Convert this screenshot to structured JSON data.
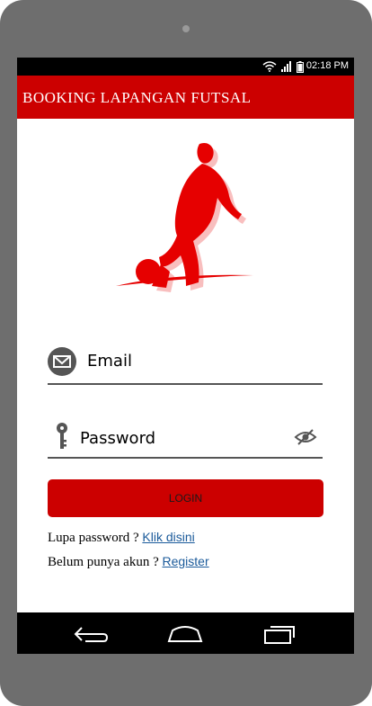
{
  "status_bar": {
    "time": "02:18 PM"
  },
  "app_bar": {
    "title": "BOOKING LAPANGAN FUTSAL"
  },
  "form": {
    "email_placeholder": "Email",
    "password_placeholder": "Password",
    "login_label": "LOGIN"
  },
  "links": {
    "forgot_text": "Lupa password ? ",
    "forgot_link": "Klik disini",
    "register_text": "Belum punya akun ? ",
    "register_link": "Register"
  },
  "colors": {
    "brand": "#cc0000",
    "link": "#1a5a9a"
  },
  "icons": [
    "mail-icon",
    "key-icon",
    "visibility-icon",
    "back-icon",
    "home-icon",
    "recents-icon"
  ]
}
